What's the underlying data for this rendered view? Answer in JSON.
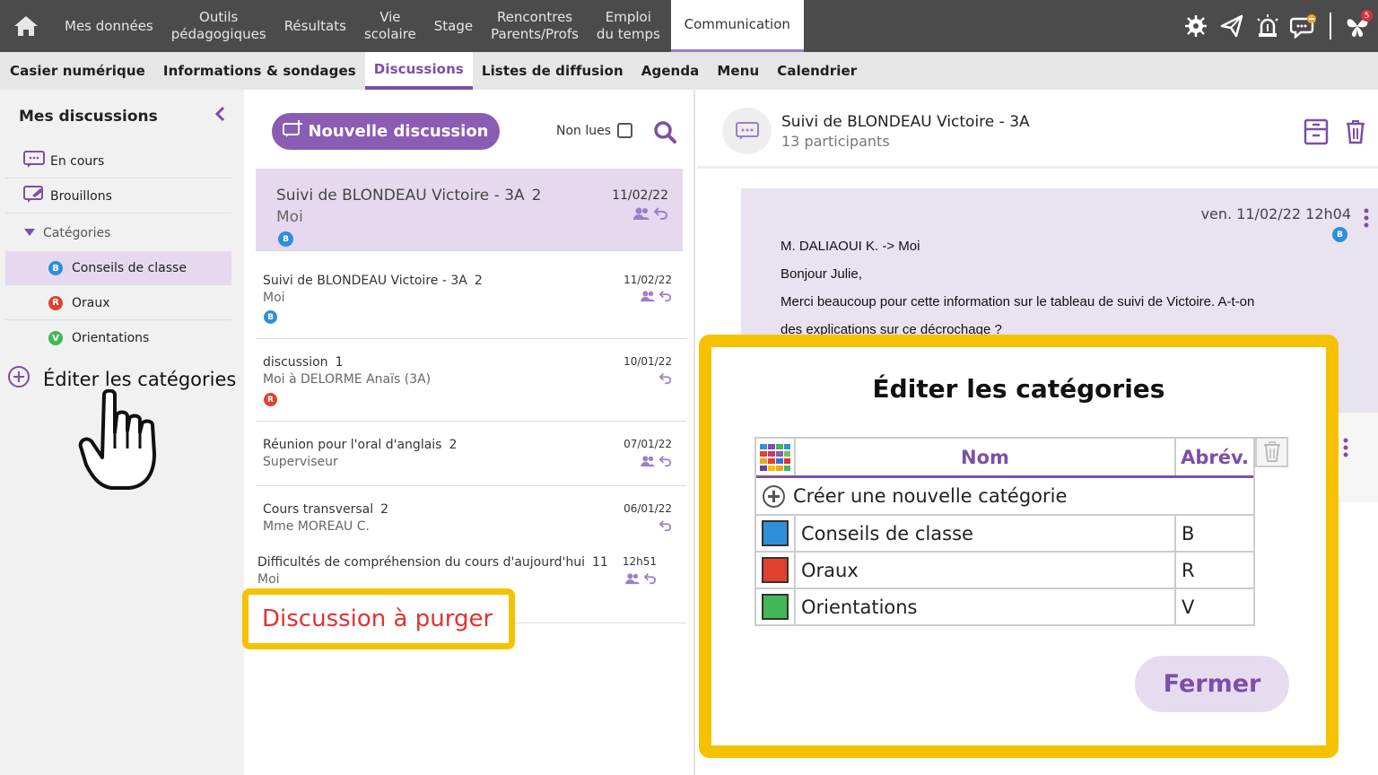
{
  "topnav": {
    "items": [
      "Mes données",
      "Outils\npédagogiques",
      "Résultats",
      "Vie\nscolaire",
      "Stage",
      "Rencontres\nParents/Profs",
      "Emploi\ndu temps",
      "Communication"
    ],
    "notif_count": "5"
  },
  "subnav": {
    "items": [
      "Casier numérique",
      "Informations & sondages",
      "Discussions",
      "Listes de diffusion",
      "Agenda",
      "Menu",
      "Calendrier"
    ]
  },
  "left": {
    "title": "Mes discussions",
    "en_cours": "En cours",
    "brouillons": "Brouillons",
    "categories": "Catégories",
    "cats": [
      {
        "letter": "B",
        "label": "Conseils de classe",
        "color": "#2f8fd8"
      },
      {
        "letter": "R",
        "label": "Oraux",
        "color": "#e0412f"
      },
      {
        "letter": "V",
        "label": "Orientations",
        "color": "#43b755"
      }
    ],
    "edit_categories": "Éditer les catégories"
  },
  "middle": {
    "new_button": "Nouvelle discussion",
    "non_lues": "Non lues",
    "discussions": [
      {
        "title": "Suivi de BLONDEAU Victoire - 3A",
        "count": "2",
        "sub": "Moi",
        "date": "11/02/22",
        "badge": "B"
      },
      {
        "title": "Suivi de BLONDEAU Victoire - 3A",
        "count": "2",
        "sub": "Moi",
        "date": "11/02/22",
        "badge": "B"
      },
      {
        "title": "discussion",
        "count": "1",
        "sub": "Moi à DELORME Anaïs (3A)",
        "date": "10/01/22",
        "badge": "R"
      },
      {
        "title": "Réunion pour l'oral d'anglais",
        "count": "2",
        "sub": "Superviseur",
        "date": "07/01/22",
        "badge": ""
      },
      {
        "title": "Cours transversal",
        "count": "2",
        "sub": "Mme MOREAU C.",
        "date": "06/01/22",
        "badge": ""
      },
      {
        "title": "Difficultés de compréhension du cours d'aujourd'hui",
        "count": "11",
        "sub": "Moi",
        "date": "12h51",
        "badge": ""
      }
    ],
    "purger_label": "Discussion à purger"
  },
  "right": {
    "title": "Suivi de BLONDEAU Victoire - 3A",
    "participants": "13 participants",
    "msg_date": "ven. 11/02/22 12h04",
    "msg_badge": "B",
    "msg_lines": [
      "M. DALIAOUI K. -> Moi",
      "Bonjour Julie,",
      "Merci beaucoup pour cette information sur le tableau de suivi de Victoire. A-t-on",
      "des explications sur ce décrochage ?"
    ]
  },
  "modal": {
    "title": "Éditer les catégories",
    "col_nom": "Nom",
    "col_abrev": "Abrév.",
    "create": "Créer une nouvelle catégorie",
    "rows": [
      {
        "nom": "Conseils de classe",
        "abrev": "B",
        "color": "#2f8fd8"
      },
      {
        "nom": "Oraux",
        "abrev": "R",
        "color": "#e0412f"
      },
      {
        "nom": "Orientations",
        "abrev": "V",
        "color": "#43b755"
      }
    ],
    "close": "Fermer"
  }
}
